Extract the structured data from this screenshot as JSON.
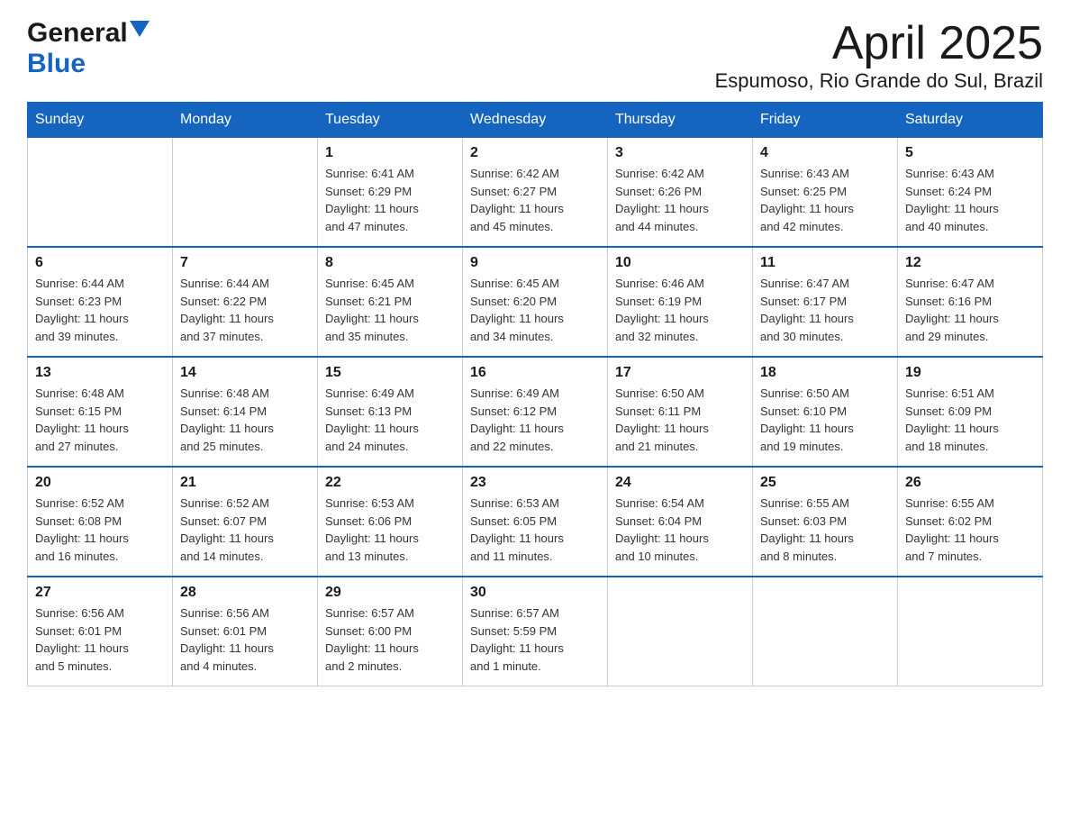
{
  "header": {
    "logo_general": "General",
    "logo_blue": "Blue",
    "month_title": "April 2025",
    "location": "Espumoso, Rio Grande do Sul, Brazil"
  },
  "days_of_week": [
    "Sunday",
    "Monday",
    "Tuesday",
    "Wednesday",
    "Thursday",
    "Friday",
    "Saturday"
  ],
  "weeks": [
    [
      {
        "day": "",
        "info": ""
      },
      {
        "day": "",
        "info": ""
      },
      {
        "day": "1",
        "info": "Sunrise: 6:41 AM\nSunset: 6:29 PM\nDaylight: 11 hours\nand 47 minutes."
      },
      {
        "day": "2",
        "info": "Sunrise: 6:42 AM\nSunset: 6:27 PM\nDaylight: 11 hours\nand 45 minutes."
      },
      {
        "day": "3",
        "info": "Sunrise: 6:42 AM\nSunset: 6:26 PM\nDaylight: 11 hours\nand 44 minutes."
      },
      {
        "day": "4",
        "info": "Sunrise: 6:43 AM\nSunset: 6:25 PM\nDaylight: 11 hours\nand 42 minutes."
      },
      {
        "day": "5",
        "info": "Sunrise: 6:43 AM\nSunset: 6:24 PM\nDaylight: 11 hours\nand 40 minutes."
      }
    ],
    [
      {
        "day": "6",
        "info": "Sunrise: 6:44 AM\nSunset: 6:23 PM\nDaylight: 11 hours\nand 39 minutes."
      },
      {
        "day": "7",
        "info": "Sunrise: 6:44 AM\nSunset: 6:22 PM\nDaylight: 11 hours\nand 37 minutes."
      },
      {
        "day": "8",
        "info": "Sunrise: 6:45 AM\nSunset: 6:21 PM\nDaylight: 11 hours\nand 35 minutes."
      },
      {
        "day": "9",
        "info": "Sunrise: 6:45 AM\nSunset: 6:20 PM\nDaylight: 11 hours\nand 34 minutes."
      },
      {
        "day": "10",
        "info": "Sunrise: 6:46 AM\nSunset: 6:19 PM\nDaylight: 11 hours\nand 32 minutes."
      },
      {
        "day": "11",
        "info": "Sunrise: 6:47 AM\nSunset: 6:17 PM\nDaylight: 11 hours\nand 30 minutes."
      },
      {
        "day": "12",
        "info": "Sunrise: 6:47 AM\nSunset: 6:16 PM\nDaylight: 11 hours\nand 29 minutes."
      }
    ],
    [
      {
        "day": "13",
        "info": "Sunrise: 6:48 AM\nSunset: 6:15 PM\nDaylight: 11 hours\nand 27 minutes."
      },
      {
        "day": "14",
        "info": "Sunrise: 6:48 AM\nSunset: 6:14 PM\nDaylight: 11 hours\nand 25 minutes."
      },
      {
        "day": "15",
        "info": "Sunrise: 6:49 AM\nSunset: 6:13 PM\nDaylight: 11 hours\nand 24 minutes."
      },
      {
        "day": "16",
        "info": "Sunrise: 6:49 AM\nSunset: 6:12 PM\nDaylight: 11 hours\nand 22 minutes."
      },
      {
        "day": "17",
        "info": "Sunrise: 6:50 AM\nSunset: 6:11 PM\nDaylight: 11 hours\nand 21 minutes."
      },
      {
        "day": "18",
        "info": "Sunrise: 6:50 AM\nSunset: 6:10 PM\nDaylight: 11 hours\nand 19 minutes."
      },
      {
        "day": "19",
        "info": "Sunrise: 6:51 AM\nSunset: 6:09 PM\nDaylight: 11 hours\nand 18 minutes."
      }
    ],
    [
      {
        "day": "20",
        "info": "Sunrise: 6:52 AM\nSunset: 6:08 PM\nDaylight: 11 hours\nand 16 minutes."
      },
      {
        "day": "21",
        "info": "Sunrise: 6:52 AM\nSunset: 6:07 PM\nDaylight: 11 hours\nand 14 minutes."
      },
      {
        "day": "22",
        "info": "Sunrise: 6:53 AM\nSunset: 6:06 PM\nDaylight: 11 hours\nand 13 minutes."
      },
      {
        "day": "23",
        "info": "Sunrise: 6:53 AM\nSunset: 6:05 PM\nDaylight: 11 hours\nand 11 minutes."
      },
      {
        "day": "24",
        "info": "Sunrise: 6:54 AM\nSunset: 6:04 PM\nDaylight: 11 hours\nand 10 minutes."
      },
      {
        "day": "25",
        "info": "Sunrise: 6:55 AM\nSunset: 6:03 PM\nDaylight: 11 hours\nand 8 minutes."
      },
      {
        "day": "26",
        "info": "Sunrise: 6:55 AM\nSunset: 6:02 PM\nDaylight: 11 hours\nand 7 minutes."
      }
    ],
    [
      {
        "day": "27",
        "info": "Sunrise: 6:56 AM\nSunset: 6:01 PM\nDaylight: 11 hours\nand 5 minutes."
      },
      {
        "day": "28",
        "info": "Sunrise: 6:56 AM\nSunset: 6:01 PM\nDaylight: 11 hours\nand 4 minutes."
      },
      {
        "day": "29",
        "info": "Sunrise: 6:57 AM\nSunset: 6:00 PM\nDaylight: 11 hours\nand 2 minutes."
      },
      {
        "day": "30",
        "info": "Sunrise: 6:57 AM\nSunset: 5:59 PM\nDaylight: 11 hours\nand 1 minute."
      },
      {
        "day": "",
        "info": ""
      },
      {
        "day": "",
        "info": ""
      },
      {
        "day": "",
        "info": ""
      }
    ]
  ]
}
